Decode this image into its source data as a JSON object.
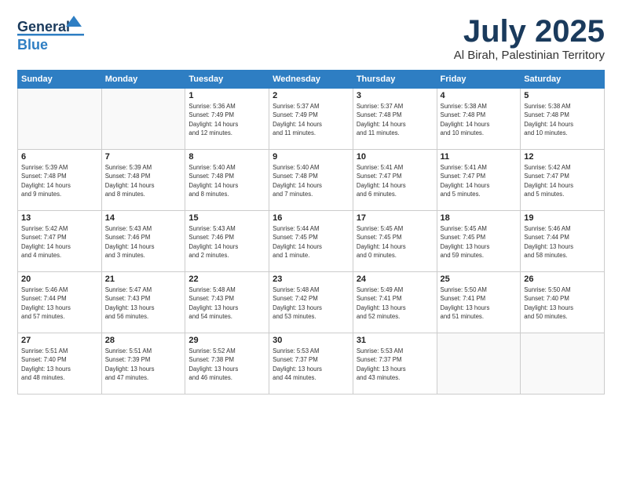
{
  "header": {
    "logo_general": "General",
    "logo_blue": "Blue",
    "title": "July 2025",
    "location": "Al Birah, Palestinian Territory"
  },
  "calendar": {
    "days_of_week": [
      "Sunday",
      "Monday",
      "Tuesday",
      "Wednesday",
      "Thursday",
      "Friday",
      "Saturday"
    ],
    "weeks": [
      [
        {
          "day": "",
          "info": ""
        },
        {
          "day": "",
          "info": ""
        },
        {
          "day": "1",
          "info": "Sunrise: 5:36 AM\nSunset: 7:49 PM\nDaylight: 14 hours\nand 12 minutes."
        },
        {
          "day": "2",
          "info": "Sunrise: 5:37 AM\nSunset: 7:49 PM\nDaylight: 14 hours\nand 11 minutes."
        },
        {
          "day": "3",
          "info": "Sunrise: 5:37 AM\nSunset: 7:48 PM\nDaylight: 14 hours\nand 11 minutes."
        },
        {
          "day": "4",
          "info": "Sunrise: 5:38 AM\nSunset: 7:48 PM\nDaylight: 14 hours\nand 10 minutes."
        },
        {
          "day": "5",
          "info": "Sunrise: 5:38 AM\nSunset: 7:48 PM\nDaylight: 14 hours\nand 10 minutes."
        }
      ],
      [
        {
          "day": "6",
          "info": "Sunrise: 5:39 AM\nSunset: 7:48 PM\nDaylight: 14 hours\nand 9 minutes."
        },
        {
          "day": "7",
          "info": "Sunrise: 5:39 AM\nSunset: 7:48 PM\nDaylight: 14 hours\nand 8 minutes."
        },
        {
          "day": "8",
          "info": "Sunrise: 5:40 AM\nSunset: 7:48 PM\nDaylight: 14 hours\nand 8 minutes."
        },
        {
          "day": "9",
          "info": "Sunrise: 5:40 AM\nSunset: 7:48 PM\nDaylight: 14 hours\nand 7 minutes."
        },
        {
          "day": "10",
          "info": "Sunrise: 5:41 AM\nSunset: 7:47 PM\nDaylight: 14 hours\nand 6 minutes."
        },
        {
          "day": "11",
          "info": "Sunrise: 5:41 AM\nSunset: 7:47 PM\nDaylight: 14 hours\nand 5 minutes."
        },
        {
          "day": "12",
          "info": "Sunrise: 5:42 AM\nSunset: 7:47 PM\nDaylight: 14 hours\nand 5 minutes."
        }
      ],
      [
        {
          "day": "13",
          "info": "Sunrise: 5:42 AM\nSunset: 7:47 PM\nDaylight: 14 hours\nand 4 minutes."
        },
        {
          "day": "14",
          "info": "Sunrise: 5:43 AM\nSunset: 7:46 PM\nDaylight: 14 hours\nand 3 minutes."
        },
        {
          "day": "15",
          "info": "Sunrise: 5:43 AM\nSunset: 7:46 PM\nDaylight: 14 hours\nand 2 minutes."
        },
        {
          "day": "16",
          "info": "Sunrise: 5:44 AM\nSunset: 7:45 PM\nDaylight: 14 hours\nand 1 minute."
        },
        {
          "day": "17",
          "info": "Sunrise: 5:45 AM\nSunset: 7:45 PM\nDaylight: 14 hours\nand 0 minutes."
        },
        {
          "day": "18",
          "info": "Sunrise: 5:45 AM\nSunset: 7:45 PM\nDaylight: 13 hours\nand 59 minutes."
        },
        {
          "day": "19",
          "info": "Sunrise: 5:46 AM\nSunset: 7:44 PM\nDaylight: 13 hours\nand 58 minutes."
        }
      ],
      [
        {
          "day": "20",
          "info": "Sunrise: 5:46 AM\nSunset: 7:44 PM\nDaylight: 13 hours\nand 57 minutes."
        },
        {
          "day": "21",
          "info": "Sunrise: 5:47 AM\nSunset: 7:43 PM\nDaylight: 13 hours\nand 56 minutes."
        },
        {
          "day": "22",
          "info": "Sunrise: 5:48 AM\nSunset: 7:43 PM\nDaylight: 13 hours\nand 54 minutes."
        },
        {
          "day": "23",
          "info": "Sunrise: 5:48 AM\nSunset: 7:42 PM\nDaylight: 13 hours\nand 53 minutes."
        },
        {
          "day": "24",
          "info": "Sunrise: 5:49 AM\nSunset: 7:41 PM\nDaylight: 13 hours\nand 52 minutes."
        },
        {
          "day": "25",
          "info": "Sunrise: 5:50 AM\nSunset: 7:41 PM\nDaylight: 13 hours\nand 51 minutes."
        },
        {
          "day": "26",
          "info": "Sunrise: 5:50 AM\nSunset: 7:40 PM\nDaylight: 13 hours\nand 50 minutes."
        }
      ],
      [
        {
          "day": "27",
          "info": "Sunrise: 5:51 AM\nSunset: 7:40 PM\nDaylight: 13 hours\nand 48 minutes."
        },
        {
          "day": "28",
          "info": "Sunrise: 5:51 AM\nSunset: 7:39 PM\nDaylight: 13 hours\nand 47 minutes."
        },
        {
          "day": "29",
          "info": "Sunrise: 5:52 AM\nSunset: 7:38 PM\nDaylight: 13 hours\nand 46 minutes."
        },
        {
          "day": "30",
          "info": "Sunrise: 5:53 AM\nSunset: 7:37 PM\nDaylight: 13 hours\nand 44 minutes."
        },
        {
          "day": "31",
          "info": "Sunrise: 5:53 AM\nSunset: 7:37 PM\nDaylight: 13 hours\nand 43 minutes."
        },
        {
          "day": "",
          "info": ""
        },
        {
          "day": "",
          "info": ""
        }
      ]
    ]
  }
}
